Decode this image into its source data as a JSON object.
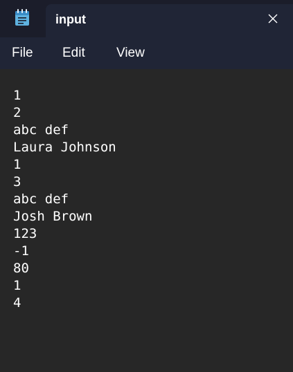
{
  "window": {
    "tab_title": "input",
    "app_icon": "notepad-icon",
    "close_icon": "close-icon"
  },
  "menu": {
    "items": [
      {
        "label": "File"
      },
      {
        "label": "Edit"
      },
      {
        "label": "View"
      }
    ]
  },
  "editor": {
    "lines": [
      "1",
      "2",
      "abc def",
      "Laura Johnson",
      "1",
      "3",
      "abc def",
      "Josh Brown",
      "123",
      "-1",
      "80",
      "1",
      "4"
    ]
  },
  "colors": {
    "titlebar": "#1b1d2a",
    "tab_and_menu": "#202536",
    "editor_background": "#272727",
    "text": "#ffffff"
  }
}
